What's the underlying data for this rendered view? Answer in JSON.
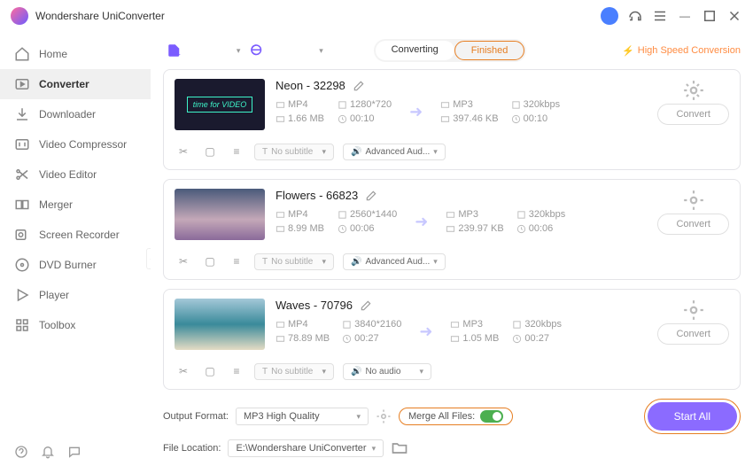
{
  "app": {
    "title": "Wondershare UniConverter"
  },
  "sidebar": {
    "items": [
      {
        "label": "Home"
      },
      {
        "label": "Converter"
      },
      {
        "label": "Downloader"
      },
      {
        "label": "Video Compressor"
      },
      {
        "label": "Video Editor"
      },
      {
        "label": "Merger"
      },
      {
        "label": "Screen Recorder"
      },
      {
        "label": "DVD Burner"
      },
      {
        "label": "Player"
      },
      {
        "label": "Toolbox"
      }
    ]
  },
  "tabs": {
    "converting": "Converting",
    "finished": "Finished"
  },
  "topright": {
    "label": "High Speed Conversion"
  },
  "neon_label": "time for VIDEO",
  "items": [
    {
      "title": "Neon - 32298",
      "src": {
        "fmt": "MP4",
        "res": "1280*720",
        "size": "1.66 MB",
        "dur": "00:10"
      },
      "dst": {
        "fmt": "MP3",
        "bitrate": "320kbps",
        "size": "397.46 KB",
        "dur": "00:10"
      },
      "subtitle": "No subtitle",
      "audio": "Advanced Aud...",
      "convert": "Convert"
    },
    {
      "title": "Flowers - 66823",
      "src": {
        "fmt": "MP4",
        "res": "2560*1440",
        "size": "8.99 MB",
        "dur": "00:06"
      },
      "dst": {
        "fmt": "MP3",
        "bitrate": "320kbps",
        "size": "239.97 KB",
        "dur": "00:06"
      },
      "subtitle": "No subtitle",
      "audio": "Advanced Aud...",
      "convert": "Convert"
    },
    {
      "title": "Waves - 70796",
      "src": {
        "fmt": "MP4",
        "res": "3840*2160",
        "size": "78.89 MB",
        "dur": "00:27"
      },
      "dst": {
        "fmt": "MP3",
        "bitrate": "320kbps",
        "size": "1.05 MB",
        "dur": "00:27"
      },
      "subtitle": "No subtitle",
      "audio": "No audio",
      "convert": "Convert"
    }
  ],
  "bottom": {
    "output_format_label": "Output Format:",
    "output_format_value": "MP3 High Quality",
    "merge_label": "Merge All Files:",
    "file_location_label": "File Location:",
    "file_location_value": "E:\\Wondershare UniConverter",
    "start_all": "Start All"
  }
}
